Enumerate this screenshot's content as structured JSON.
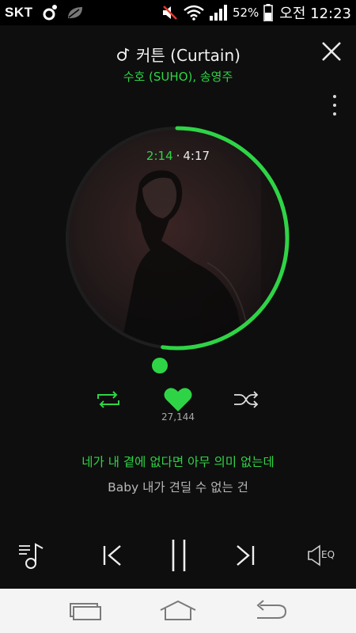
{
  "status_bar": {
    "carrier": "SKT",
    "battery_percent": "52%",
    "time": "오전 12:23",
    "icons": [
      "music-note-status-icon",
      "leaf-icon",
      "mute-icon",
      "wifi-icon",
      "signal-icon",
      "battery-icon"
    ]
  },
  "player": {
    "title": "커튼 (Curtain)",
    "artist": "수호 (SUHO), 송영주",
    "elapsed": "2:14",
    "separator": "·",
    "duration": "4:17",
    "progress_fraction": 0.521,
    "likes": "27,144",
    "lyrics": {
      "current": "네가 내 곁에 없다면 아무 의미 없는데",
      "next": "Baby 내가 견딜 수 없는 건"
    },
    "eq_label": "EQ"
  },
  "colors": {
    "accent": "#2fd446",
    "background": "#0e0e0e",
    "navbar": "#f4f4f4"
  },
  "icons": {
    "close": "close-icon",
    "more": "more-vertical-icon",
    "repeat": "repeat-icon",
    "like": "heart-icon",
    "shuffle": "shuffle-icon",
    "playlist": "playlist-icon",
    "prev": "previous-icon",
    "pause": "pause-icon",
    "next": "next-icon",
    "eq": "equalizer-speaker-icon",
    "nav": [
      "recent-apps-icon",
      "home-icon",
      "back-icon"
    ]
  }
}
